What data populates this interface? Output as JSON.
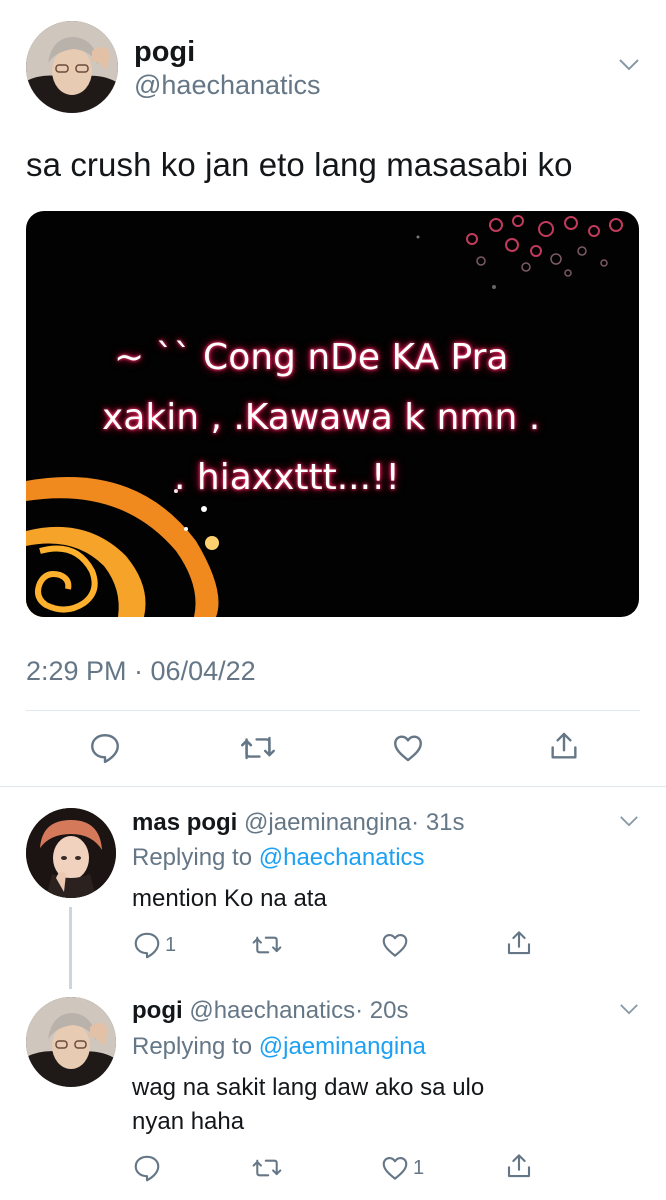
{
  "main_tweet": {
    "name": "pogi",
    "handle": "@haechanatics",
    "text": "sa crush ko jan eto lang masasabi ko",
    "media": {
      "lines": [
        "~ `` Cong nDe KA Pra",
        "xakin , .Kawawa k nmn .",
        ". hiaxxttt...!!"
      ]
    },
    "timestamp": "2:29 PM · 06/04/22"
  },
  "replies": [
    {
      "name": "mas pogi",
      "handle": "@jaeminangina",
      "time": "· 31s",
      "replying_prefix": "Replying to",
      "replying_to": "@haechanatics",
      "text": "mention Ko na ata",
      "reply_count": "1",
      "like_count": ""
    },
    {
      "name": "pogi",
      "handle": "@haechanatics",
      "time": "· 20s",
      "replying_prefix": "Replying to",
      "replying_to": "@jaeminangina",
      "text_lines": [
        "wag na sakit lang daw ako sa ulo",
        "nyan haha"
      ],
      "reply_count": "",
      "like_count": "1"
    }
  ],
  "icons": {
    "reply": "speech-bubble-icon",
    "retweet": "retweet-arrows-icon",
    "like": "heart-outline-icon",
    "share": "share-upload-icon",
    "more": "chevron-down-icon"
  },
  "colors": {
    "text": "#14171a",
    "muted": "#657786",
    "link": "#1da1f2",
    "divider": "#e1e8ed",
    "icon": "#657786"
  }
}
